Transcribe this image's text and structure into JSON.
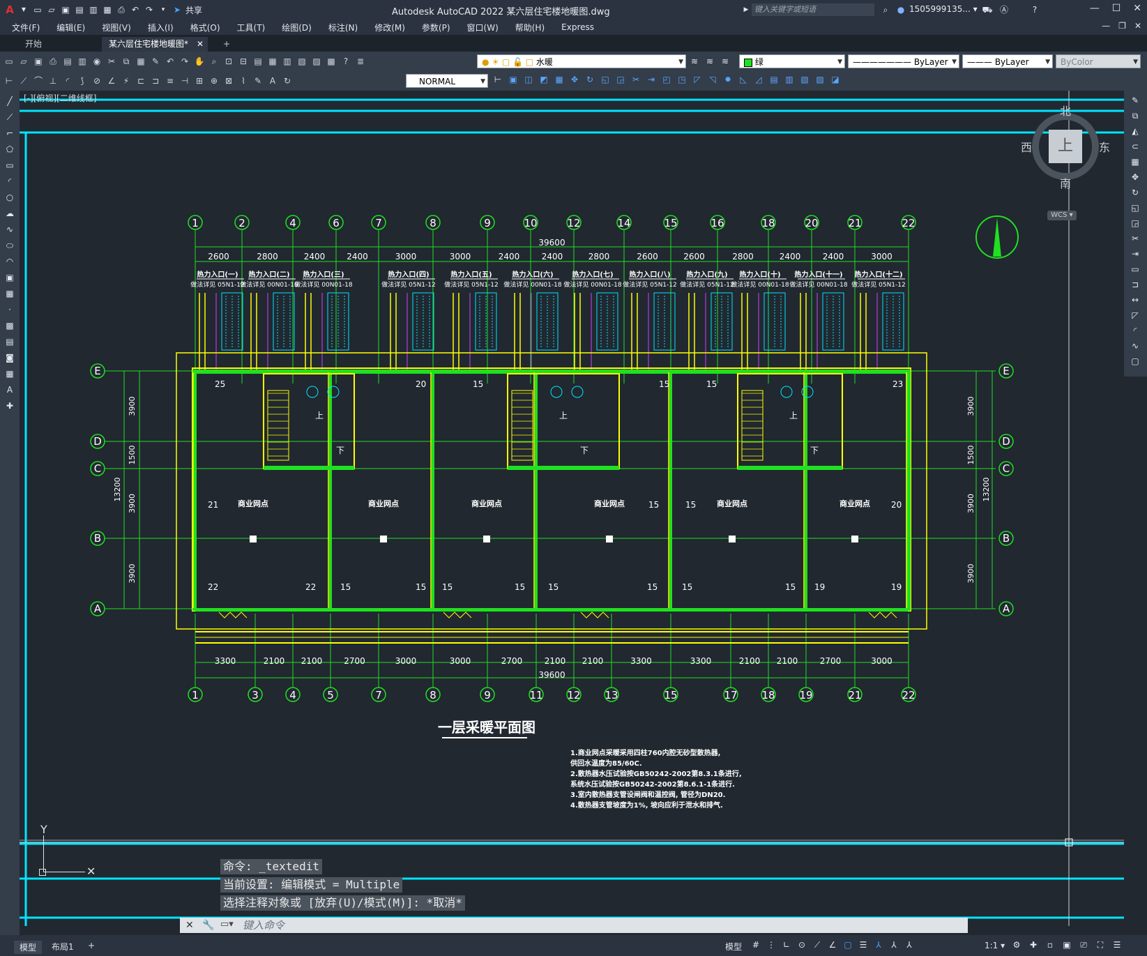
{
  "app": {
    "title": "Autodesk AutoCAD 2022    某六层住宅楼地暖图.dwg",
    "search_placeholder": "键入关键字或短语",
    "user": "1505999135... ▾",
    "share": "共享"
  },
  "menu": [
    "文件(F)",
    "编辑(E)",
    "视图(V)",
    "插入(I)",
    "格式(O)",
    "工具(T)",
    "绘图(D)",
    "标注(N)",
    "修改(M)",
    "参数(P)",
    "窗口(W)",
    "帮助(H)",
    "Express"
  ],
  "tabs": {
    "start": "开始",
    "doc": "某六层住宅楼地暖图*",
    "add": "+"
  },
  "toolbar": {
    "layer": "水暖",
    "color": "绿",
    "linetype": "ByLayer",
    "lineweight": "ByLayer",
    "plotstyle": "ByColor",
    "dimstyle": "NORMAL"
  },
  "viewcube": {
    "north": "北",
    "south": "南",
    "east": "东",
    "west": "西",
    "top": "上",
    "wcs": "WCS ▾"
  },
  "viewport_label": "[-][俯视][二维线框]",
  "drawing": {
    "top_axes": [
      "1",
      "2",
      "4",
      "6",
      "7",
      "8",
      "9",
      "10",
      "12",
      "14",
      "15",
      "16",
      "18",
      "20",
      "21",
      "22"
    ],
    "top_dims": [
      "2600",
      "2800",
      "2400",
      "2400",
      "3000",
      "3000",
      "2400",
      "2400",
      "2800",
      "2600",
      "2600",
      "2800",
      "2400",
      "2400",
      "3000"
    ],
    "total_dim": "39600",
    "bottom_axes": [
      "1",
      "3",
      "4",
      "5",
      "7",
      "8",
      "9",
      "11",
      "12",
      "13",
      "15",
      "17",
      "18",
      "19",
      "21",
      "22"
    ],
    "bottom_dims": [
      "3300",
      "2100",
      "2100",
      "2700",
      "3000",
      "3000",
      "2700",
      "2100",
      "2100",
      "3300",
      "3300",
      "2100",
      "2100",
      "2700",
      "3000"
    ],
    "row_axes": [
      "E",
      "D",
      "C",
      "B",
      "A"
    ],
    "row_dims": [
      "3900",
      "1500",
      "3900",
      "3900"
    ],
    "side_total": "13200",
    "entries": [
      {
        "t": "热力入口(一)",
        "s": "做法详见 05N1-12"
      },
      {
        "t": "热力入口(二)",
        "s": "做法详见 00N01-18"
      },
      {
        "t": "热力入口(三)",
        "s": "做法详见 00N01-18"
      },
      {
        "t": "热力入口(四)",
        "s": "做法详见 05N1-12"
      },
      {
        "t": "热力入口(五)",
        "s": "做法详见 05N1-12"
      },
      {
        "t": "热力入口(六)",
        "s": "做法详见 00N01-18"
      },
      {
        "t": "热力入口(七)",
        "s": "做法详见 00N01-18"
      },
      {
        "t": "热力入口(八)",
        "s": "做法详见 05N1-12"
      },
      {
        "t": "热力入口(九)",
        "s": "做法详见 05N1-12"
      },
      {
        "t": "热力入口(十)",
        "s": "做法详见 00N01-18"
      },
      {
        "t": "热力入口(十一)",
        "s": "做法详见 00N01-18"
      },
      {
        "t": "热力入口(十二)",
        "s": "做法详见 05N1-12"
      }
    ],
    "shop_label": "商业网点",
    "up": "上",
    "down": "下",
    "title": "一层采暖平面图",
    "notes": [
      "1.商业网点采暖采用四柱760内腔无砂型散热器,",
      "  供回水温度为85/60C.",
      "2.散热器水压试验按GB50242-2002第8.3.1条进行,",
      "  系统水压试验按GB50242-2002第8.6.1-1条进行.",
      "3.室内散热器支管设闸阀和温控阀, 管径为DN20.",
      "4.散热器支管坡度为1%, 坡向应利于泄水和排气."
    ]
  },
  "command": {
    "line1": "命令: _textedit",
    "line2": "当前设置: 编辑模式 = Multiple",
    "line3": "选择注释对象或 [放弃(U)/模式(M)]: *取消*",
    "placeholder": "键入命令"
  },
  "status": {
    "model_tab": "模型",
    "layout_tab": "布局1",
    "add": "+",
    "model": "模型",
    "scale": "1:1 ▾"
  },
  "colors": {
    "cyan": "#00e5ff",
    "green": "#20e020",
    "yellow": "#ffff00",
    "magenta": "#d040ff"
  }
}
